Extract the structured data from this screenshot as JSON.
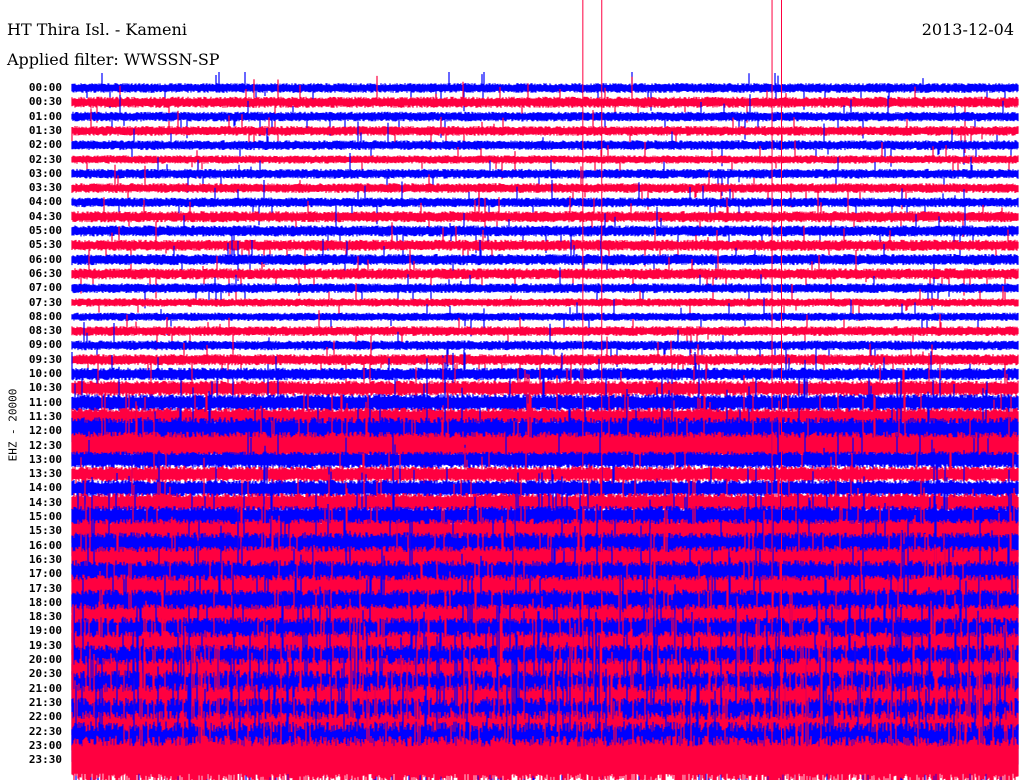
{
  "header": {
    "station": "HT Thira Isl. - Kameni",
    "date": "2013-12-04",
    "filter": "Applied filter: WWSSN-SP"
  },
  "chart_data": {
    "type": "line",
    "title": "HT Thira Isl. - Kameni",
    "ylabel": "EHZ - 20000",
    "row_labels": [
      "00:00",
      "00:30",
      "01:00",
      "01:30",
      "02:00",
      "02:30",
      "03:00",
      "03:30",
      "04:00",
      "04:30",
      "05:00",
      "05:30",
      "06:00",
      "06:30",
      "07:00",
      "07:30",
      "08:00",
      "08:30",
      "09:00",
      "09:30",
      "10:00",
      "10:30",
      "11:00",
      "11:30",
      "12:00",
      "12:30",
      "13:00",
      "13:30",
      "14:00",
      "14:30",
      "15:00",
      "15:30",
      "16:00",
      "16:30",
      "17:00",
      "17:30",
      "18:00",
      "18:30",
      "19:00",
      "19:30",
      "20:00",
      "20:30",
      "21:00",
      "21:30",
      "22:00",
      "22:30",
      "23:00",
      "23:30"
    ],
    "relative_amplitude": [
      0.7,
      0.8,
      0.7,
      0.7,
      0.7,
      0.6,
      0.7,
      0.7,
      0.7,
      0.8,
      0.8,
      0.8,
      0.8,
      0.8,
      0.7,
      0.6,
      0.6,
      0.7,
      0.7,
      0.8,
      0.9,
      1.1,
      1.2,
      1.3,
      2.0,
      2.0,
      1.2,
      1.1,
      1.2,
      1.4,
      1.6,
      1.8,
      1.9,
      2.0,
      2.0,
      2.0,
      1.9,
      1.9,
      2.0,
      2.1,
      2.2,
      2.4,
      2.6,
      2.8,
      2.8,
      3.0,
      3.5,
      3.5
    ],
    "colors": [
      "#0000ff",
      "#ff0040"
    ],
    "event_markers_minutes": [
      16.2,
      16.8,
      22.2,
      22.5
    ],
    "legend": "none",
    "grid": false
  }
}
